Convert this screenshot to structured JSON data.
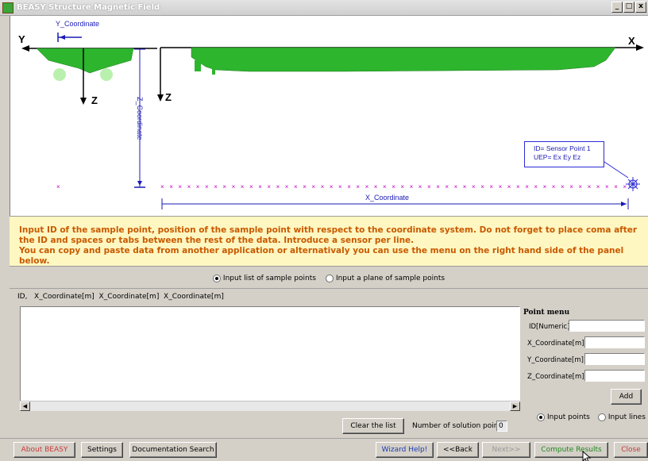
{
  "window": {
    "title": "BEASY Structure Magnetic Field",
    "controls": [
      "_",
      "□",
      "x"
    ]
  },
  "diagram": {
    "y_coordinate_label": "Y_Coordinate",
    "z_coordinate_label": "Z_Coordinate",
    "x_coordinate_label": "X_Coordinate",
    "axis_y": "Y",
    "axis_x": "X",
    "axis_z_left": "Z",
    "axis_z_right": "Z",
    "callout_line1": "ID= Sensor Point 1",
    "callout_line2": "UEP= Ex Ey Ez",
    "colors": {
      "hull": "#2db52d",
      "sensor_marks": "#c000c0",
      "axis_annotations": "#1a1ab5"
    }
  },
  "instructions": {
    "line1": "Input ID of the sample point, position of the sample point with respect to the coordinate system. Do not forget to place coma after the ID and spaces or tabs between the rest of the data. Introduce a sensor per line.",
    "line2": "You can copy and paste data from another application or alternativaly you can use the menu on the right hand side of the panel below."
  },
  "mode": {
    "option1": "Input list of sample points",
    "option2": "Input a plane of sample points",
    "selected": "Input list of sample points"
  },
  "list": {
    "columns_header": "ID,   X_Coordinate[m]  X_Coordinate[m]  X_Coordinate[m]",
    "content": "",
    "clear_label": "Clear the list",
    "solution_points_label": "Number of solution points",
    "solution_points_value": "0"
  },
  "point_menu": {
    "title": "Point menu",
    "id_label": "ID[Numeric]",
    "x_label": "X_Coordinate[m]",
    "y_label": "Y_Coordinate[m]",
    "z_label": "Z_Coordinate[m]",
    "add_label": "Add",
    "radio_points": "Input points",
    "radio_lines": "Input lines",
    "selected": "Input points"
  },
  "footer": {
    "about": "About BEASY",
    "settings": "Settings",
    "doc_search": "Documentation Search",
    "wizard_help": "Wizard Help!",
    "back": "<<Back",
    "next": "Next>>",
    "compute": "Compute Results",
    "close": "Close"
  }
}
